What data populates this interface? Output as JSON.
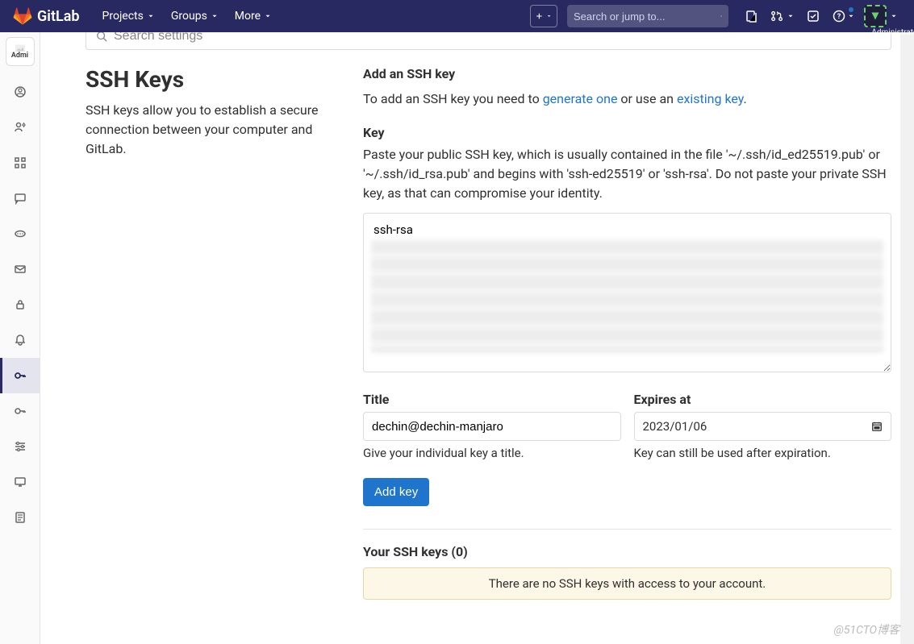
{
  "navbar": {
    "brand": "GitLab",
    "items": [
      "Projects",
      "Groups",
      "More"
    ],
    "search_placeholder": "Search or jump to...",
    "user_label": "Administrator"
  },
  "sidebar": {
    "avatar_text": "Admi"
  },
  "search_settings_placeholder": "Search settings",
  "left": {
    "heading": "SSH Keys",
    "desc": "SSH keys allow you to establish a secure connection between your computer and GitLab."
  },
  "add": {
    "heading": "Add an SSH key",
    "intro_before": "To add an SSH key you need to ",
    "link_generate": "generate one",
    "intro_mid": " or use an ",
    "link_existing": "existing key",
    "intro_after": "."
  },
  "key": {
    "label": "Key",
    "help": "Paste your public SSH key, which is usually contained in the file '~/.ssh/id_ed25519.pub' or '~/.ssh/id_rsa.pub' and begins with 'ssh-ed25519' or 'ssh-rsa'. Do not paste your private SSH key, as that can compromise your identity.",
    "value_visible": "ssh-rsa"
  },
  "title_field": {
    "label": "Title",
    "value": "dechin@dechin-manjaro",
    "hint": "Give your individual key a title."
  },
  "expires_field": {
    "label": "Expires at",
    "value": "2023/01/06",
    "hint": "Key can still be used after expiration."
  },
  "add_button": "Add key",
  "your_keys_heading": "Your SSH keys (0)",
  "empty_msg": "There are no SSH keys with access to your account.",
  "watermark": "@51CTO博客"
}
